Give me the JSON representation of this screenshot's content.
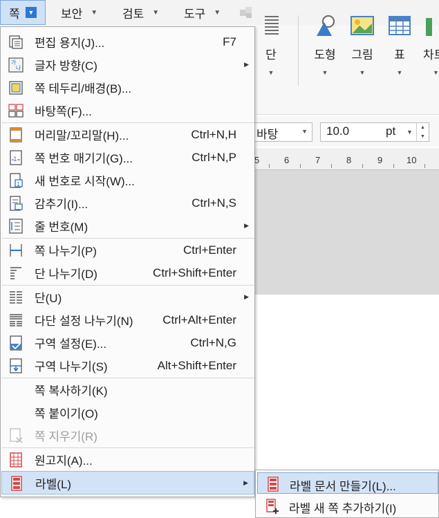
{
  "menubar": {
    "items": [
      {
        "label": "쪽"
      },
      {
        "label": "보안"
      },
      {
        "label": "검토"
      },
      {
        "label": "도구"
      }
    ]
  },
  "ribbon": {
    "buttons": [
      {
        "label": "단"
      },
      {
        "label": "도형"
      },
      {
        "label": "그림"
      },
      {
        "label": "표"
      },
      {
        "label": "차트"
      }
    ]
  },
  "format": {
    "font_name": "바탕",
    "font_size": "10.0",
    "font_unit": "pt"
  },
  "ruler": {
    "ticks": [
      "5",
      "6",
      "7",
      "8",
      "9",
      "10"
    ]
  },
  "menu": {
    "items": [
      {
        "label": "편집 용지(J)...",
        "shortcut": "F7"
      },
      {
        "label": "글자 방향(C)",
        "shortcut": "",
        "submenu": true
      },
      {
        "label": "쪽 테두리/배경(B)...",
        "shortcut": ""
      },
      {
        "label": "바탕쪽(F)...",
        "shortcut": ""
      },
      {
        "label": "머리말/꼬리말(H)...",
        "shortcut": "Ctrl+N,H"
      },
      {
        "label": "쪽 번호 매기기(G)...",
        "shortcut": "Ctrl+N,P"
      },
      {
        "label": "새 번호로 시작(W)...",
        "shortcut": ""
      },
      {
        "label": "감추기(I)...",
        "shortcut": "Ctrl+N,S"
      },
      {
        "label": "줄 번호(M)",
        "shortcut": "",
        "submenu": true
      },
      {
        "label": "쪽 나누기(P)",
        "shortcut": "Ctrl+Enter"
      },
      {
        "label": "단 나누기(D)",
        "shortcut": "Ctrl+Shift+Enter"
      },
      {
        "label": "단(U)",
        "shortcut": "",
        "submenu": true
      },
      {
        "label": "다단 설정 나누기(N)",
        "shortcut": "Ctrl+Alt+Enter"
      },
      {
        "label": "구역 설정(E)...",
        "shortcut": "Ctrl+N,G"
      },
      {
        "label": "구역 나누기(S)",
        "shortcut": "Alt+Shift+Enter"
      },
      {
        "label": "쪽 복사하기(K)",
        "shortcut": ""
      },
      {
        "label": "쪽 붙이기(O)",
        "shortcut": ""
      },
      {
        "label": "쪽 지우기(R)",
        "shortcut": "",
        "disabled": true
      },
      {
        "label": "원고지(A)...",
        "shortcut": ""
      },
      {
        "label": "라벨(L)",
        "shortcut": "",
        "submenu": true,
        "highlighted": true
      }
    ]
  },
  "submenu": {
    "items": [
      {
        "label": "라벨 문서 만들기(L)...",
        "highlighted": true
      },
      {
        "label": "라벨 새 쪽 추가하기(I)"
      }
    ]
  },
  "colors": {
    "highlight": "#d3e3f7",
    "accent": "#2f77d0",
    "label_red": "#d9534f"
  }
}
